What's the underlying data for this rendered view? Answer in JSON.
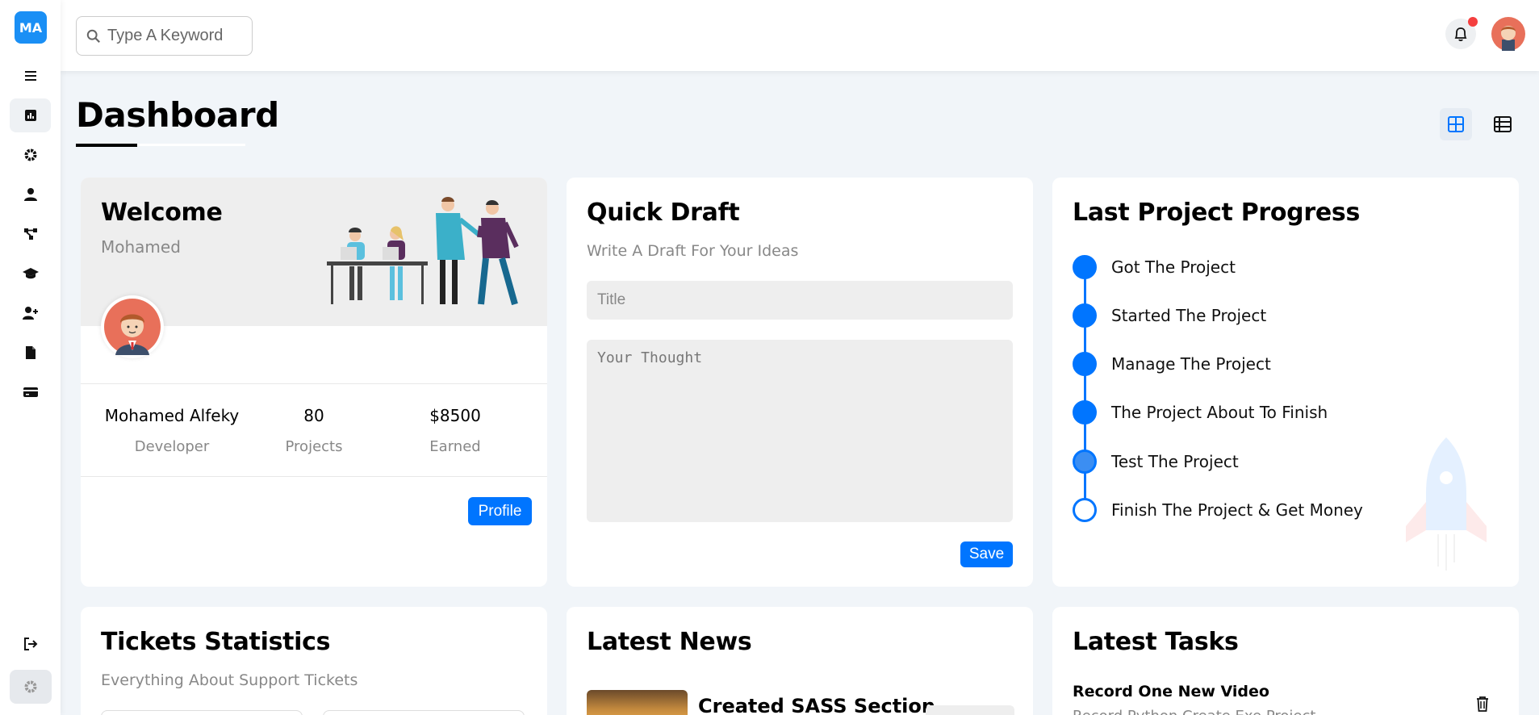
{
  "sidebar": {
    "logo": "MA",
    "items": [
      {
        "icon": "menu-icon"
      },
      {
        "icon": "dashboard-icon",
        "active": true
      },
      {
        "icon": "settings-icon"
      },
      {
        "icon": "profile-icon"
      },
      {
        "icon": "projects-icon"
      },
      {
        "icon": "courses-icon"
      },
      {
        "icon": "friends-icon"
      },
      {
        "icon": "files-icon"
      },
      {
        "icon": "plans-icon"
      },
      {
        "icon": "logout-icon"
      }
    ]
  },
  "header": {
    "search_placeholder": "Type A Keyword",
    "notification_unread": true
  },
  "page": {
    "title": "Dashboard"
  },
  "welcome": {
    "title": "Welcome",
    "name": "Mohamed",
    "stats": [
      {
        "value": "Mohamed Alfeky",
        "label": "Developer"
      },
      {
        "value": "80",
        "label": "Projects"
      },
      {
        "value": "$8500",
        "label": "Earned"
      }
    ],
    "profile_button": "Profile"
  },
  "draft": {
    "title": "Quick Draft",
    "subtitle": "Write A Draft For Your Ideas",
    "title_placeholder": "Title",
    "thought_placeholder": "Your Thought",
    "save_button": "Save"
  },
  "progress": {
    "title": "Last Project Progress",
    "steps": [
      {
        "label": "Got The Project",
        "state": "done"
      },
      {
        "label": "Started The Project",
        "state": "done"
      },
      {
        "label": "Manage The Project",
        "state": "done"
      },
      {
        "label": "The Project About To Finish",
        "state": "done"
      },
      {
        "label": "Test The Project",
        "state": "current"
      },
      {
        "label": "Finish The Project & Get Money",
        "state": "pending"
      }
    ]
  },
  "tickets": {
    "title": "Tickets Statistics",
    "subtitle": "Everything About Support Tickets"
  },
  "news": {
    "title": "Latest News",
    "first_item_title": "Created SASS Section"
  },
  "tasks": {
    "title": "Latest Tasks",
    "first_task_title": "Record One New Video",
    "first_task_sub": "Record Python Create Exe Project"
  },
  "colors": {
    "accent": "#0075ff",
    "logo_bg": "#1a8ff5",
    "notify_dot": "#f43f3f",
    "page_bg": "#f1f5f9"
  }
}
